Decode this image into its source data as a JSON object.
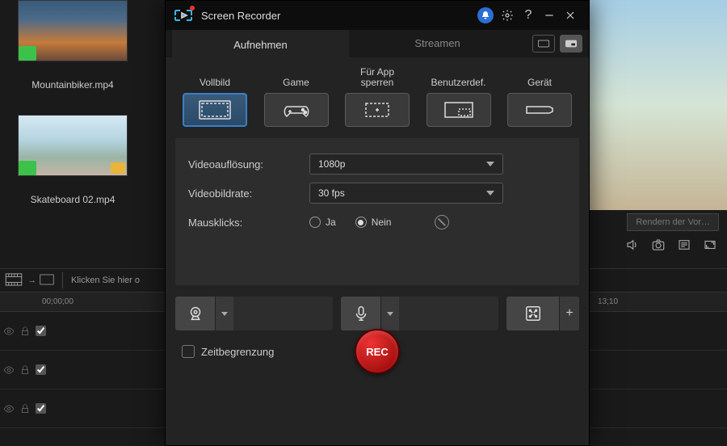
{
  "media": {
    "thumbs": [
      {
        "label": "Mountainbiker.mp4"
      },
      {
        "label": "Skateboard 02.mp4"
      }
    ]
  },
  "editor": {
    "render_preview": "Rendern der Vor…",
    "click_hint": "Klicken Sie hier o",
    "timecode_start": "00;00;00",
    "timecode_mark": "13;10"
  },
  "dialog": {
    "title": "Screen Recorder",
    "tabs": {
      "record": "Aufnehmen",
      "stream": "Streamen"
    },
    "modes": {
      "fullscreen": "Vollbild",
      "game": "Game",
      "lockapp": "Für App sperren",
      "custom": "Benutzerdef.",
      "device": "Gerät"
    },
    "settings": {
      "resolution_label": "Videoauflösung:",
      "resolution_value": "1080p",
      "framerate_label": "Videobildrate:",
      "framerate_value": "30 fps",
      "clicks_label": "Mausklicks:",
      "yes": "Ja",
      "no": "Nein"
    },
    "footer": {
      "timelimit": "Zeitbegrenzung",
      "rec": "REC"
    }
  }
}
